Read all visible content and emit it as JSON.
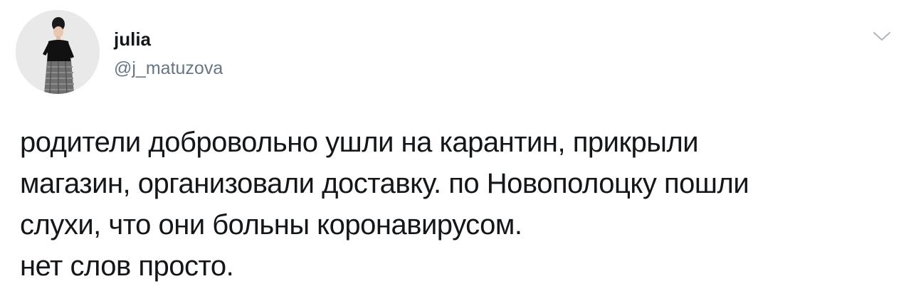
{
  "tweet": {
    "author": {
      "display_name": "julia",
      "handle": "@j_matuzova",
      "avatar_icon": "user-avatar-photo"
    },
    "menu_icon": "chevron-down-icon",
    "text_lines": [
      "родители добровольно ушли на карантин, прикрыли",
      "магазин, организовали доставку. по Новополоцку пошли",
      "слухи, что они больны коронавирусом.",
      "нет слов просто."
    ]
  },
  "colors": {
    "text_primary": "#14171a",
    "text_secondary": "#657786",
    "chevron": "#aab8c2",
    "background": "#ffffff"
  }
}
